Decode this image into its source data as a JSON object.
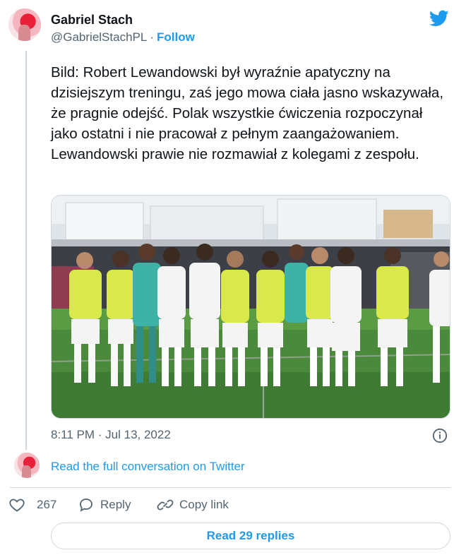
{
  "author": {
    "name": "Gabriel Stach",
    "handle": "@GabrielStachPL",
    "separator": "·",
    "follow_label": "Follow"
  },
  "tweet": {
    "text": "Bild: Robert Lewandowski był wyraźnie apatyczny na dzisiejszym treningu, zaś jego mowa ciała jasno wskazywała, że pragnie odejść. Polak wszystkie ćwiczenia rozpoczynał jako ostatni i nie pracował z pełnym zaangażowaniem. Lewandowski prawie nie rozmawiał z kolegami z zespołu.",
    "timestamp": "8:11 PM · Jul 13, 2022"
  },
  "read_full_label": "Read the full conversation on Twitter",
  "actions": {
    "like_count": "267",
    "reply_label": "Reply",
    "copy_link_label": "Copy link"
  },
  "read_replies_label": "Read 29 replies",
  "colors": {
    "accent": "#1d9bf0",
    "secondary_text": "#536471",
    "border": "#cfd9de"
  },
  "icons": {
    "logo": "twitter-bird-icon",
    "info": "info-icon",
    "like": "heart-icon",
    "reply": "reply-bubble-icon",
    "copy": "link-icon"
  }
}
